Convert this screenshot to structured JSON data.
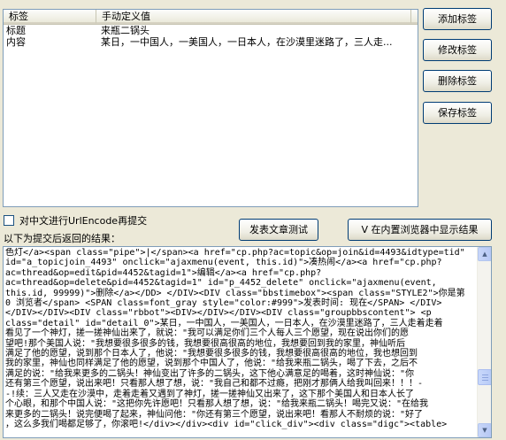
{
  "listview": {
    "columns": [
      "标签",
      "手动定义值"
    ],
    "rows": [
      {
        "label": "标题",
        "value": "来瓶二锅头"
      },
      {
        "label": "内容",
        "value": "某日，一中国人，一美国人，一日本人，在沙漠里迷路了，三人走..."
      }
    ]
  },
  "buttons": {
    "add": "添加标签",
    "edit": "修改标签",
    "delete": "删除标签",
    "save": "保存标签",
    "publish_test": "发表文章测试",
    "show_browser": "V  在内置浏览器中显示结果"
  },
  "options": {
    "url_encode_label": "对中文进行UrlEncode再提交",
    "url_encode_checked": false
  },
  "result": {
    "label": "以下为提交后返回的结果：",
    "lines": [
      "色灯</a><span class=\"pipe\">|</span><a href=\"cp.php?ac=topic&op=join&id=4493&idtype=tid\"",
      "id=\"a_topicjoin_4493\" onclick=\"ajaxmenu(event, this.id)\">凑热闹</a><a href=\"cp.php?",
      "ac=thread&op=edit&pid=4452&tagid=1\">编辑</a><a href=\"cp.php?",
      "ac=thread&op=delete&pid=4452&tagid=1\" id=\"p_4452_delete\" onclick=\"ajaxmenu(event,",
      "this.id, 99999)\">删除</a></DD> </DIV><DIV class=\"bbstimebox\"><span class=\"STYLE2\">你是第",
      "0 浏览者</span> <SPAN class=font_gray style=\"color:#999\">发表时间: 现在</SPAN> </DIV>",
      "</DIV></DIV><DIV class=\"rbbot\"><DIV></DIV></DIV><DIV class=\"groupbbscontent\"> <p",
      "class=\"detail\" id=\"detail_0\">某日，一中国人，一美国人，一日本人，在沙漠里迷路了，三人走着走着",
      "看见了一个神灯，搓一搓神仙出来了，就说：\"我可以满足你们三个人每人三个愿望，现在说出你们的愿",
      "望吧!那个美国人说：\"我想要很多很多的钱，我想要很高很高的地位，我想要回到我的家里，神仙听后",
      "满足了他的愿望，说到那个日本人了，他说：\"我想要很多很多的钱，我想要很高很高的地位，我也想回到",
      "我的家里，神仙也同样满足了他的愿望，说到那个中国人了，他说：\"给我来瓶二锅头，喝了下去，之后不",
      "满足的说：\"给我来更多的二锅头！神仙变出了许多的二锅头，这下他心满意足的喝着，这时神仙说：\"你",
      "还有第三个愿望，说出来吧！只看那人想了想，说：\"我自己和都不过瘾，把刚才那俩人给我叫回来！！！-",
      "-!续：三人又走在沙漠中，走着走着又遇到了神灯，搓一搓神仙又出来了，这下那个美国人和日本人长了",
      "个心眼，和那个中国人说：\"这把你先许愿吧！只看那人想了想，说：\"给我来瓶二锅头！喝完又说：\"在给我",
      "来更多的二锅头！说完便喝了起来，神仙问他：\"你还有第三个愿望，说出来吧！看那人不耐烦的说：\"好了",
      "，这么多我们喝都足够了，你滚吧!</div></div><div id=\"click_div\"><div class=\"digc\"><table>"
    ]
  }
}
